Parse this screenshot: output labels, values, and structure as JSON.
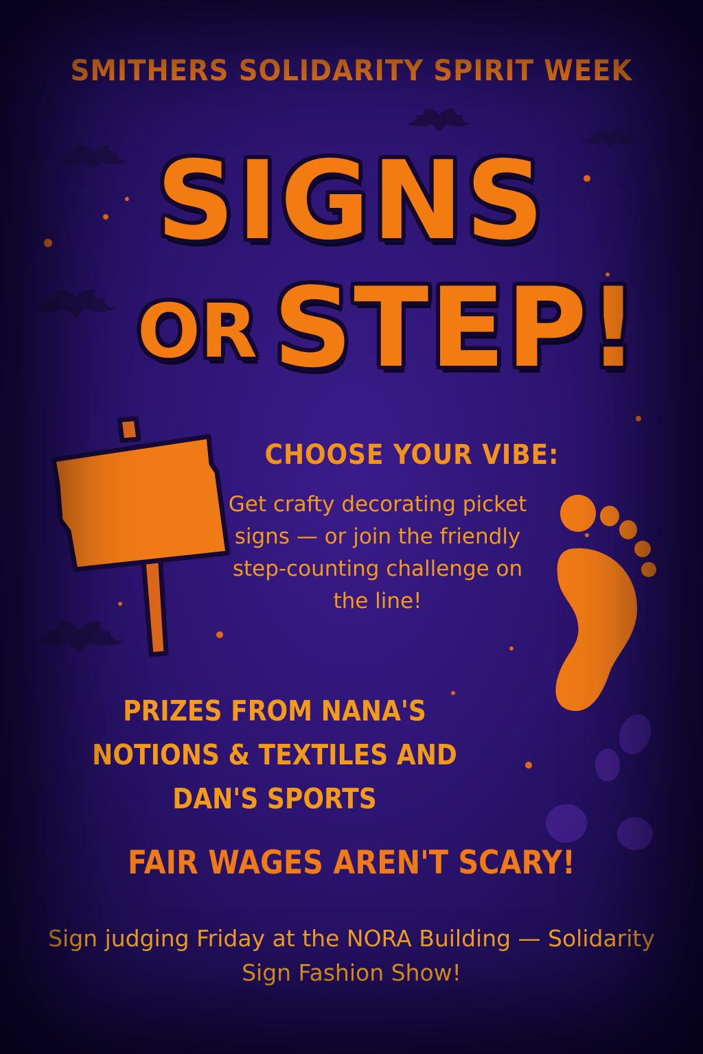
{
  "poster": {
    "top_title": "SMITHERS SOLIDARITY SPIRIT WEEK",
    "headline": {
      "line1": "SIGNS",
      "or": "OR",
      "step": "STEP!"
    },
    "choose_heading": "CHOOSE YOUR VIBE:",
    "choose_body": "Get crafty decorating picket signs — or join the friendly step-counting challenge on the line!",
    "prizes": "PRIZES FROM NANA'S NOTIONS & TEXTILES AND DAN'S SPORTS",
    "slogan": "FAIR WAGES AREN'T SCARY!",
    "footer": "Sign judging Friday at the NORA Building — Solidarity Sign Fashion Show!"
  },
  "icons": {
    "sign": "picket-sign-icon",
    "footprint": "footprint-icon",
    "bat": "bat-icon"
  },
  "colors": {
    "background": "#2c1470",
    "accent_orange": "#f27b12",
    "text_amber": "#f39a1a",
    "outline_dark": "#120830"
  }
}
